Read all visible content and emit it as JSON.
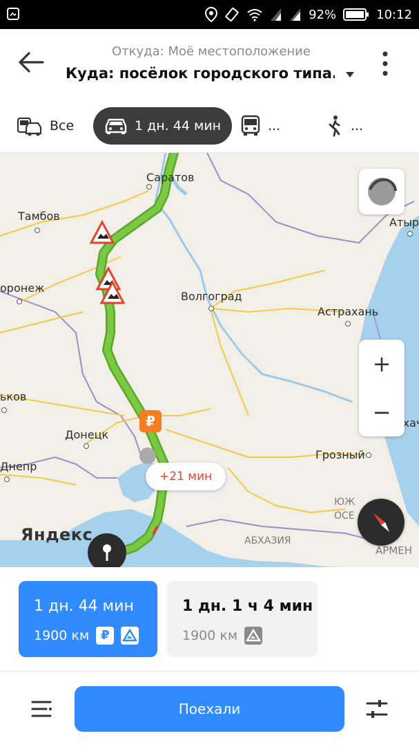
{
  "status_bar": {
    "battery": "92%",
    "time": "10:12",
    "icons": [
      "notification-icon",
      "location-icon",
      "vibrate-icon",
      "wifi-icon",
      "signal-icon",
      "signal-icon",
      "battery-icon"
    ]
  },
  "header": {
    "from": "Откуда: Моё местоположение",
    "to": "Куда: посёлок городского типа...",
    "icons": [
      "back-arrow-icon",
      "dropdown-triangle-icon",
      "more-vert-icon"
    ]
  },
  "modes": [
    {
      "label": "Все",
      "icon": "car-and-bus-icon"
    },
    {
      "label": "1 дн. 44 мин",
      "icon": "car-icon",
      "active": true
    },
    {
      "label": "...",
      "icon": "bus-icon"
    },
    {
      "label": "...",
      "icon": "walk-icon"
    }
  ],
  "map": {
    "cities": [
      "Саратов",
      "Тамбов",
      "Атыр",
      "оронеж",
      "Волгоград",
      "Астрахань",
      "ьков",
      "Донецк",
      "Махач",
      "Грозный",
      "Днепр",
      "ЮЖ",
      "ОСЕ",
      "АБХАЗИЯ",
      "АРМЕН"
    ],
    "logo": "Яндекс",
    "time_badge": "+21 мин",
    "toll_marker": "₽",
    "zoom_in": "+",
    "zoom_out": "−",
    "colors": {
      "route": "#7ac943",
      "land": "#f2efe9",
      "sea": "#a6d1ec",
      "roads": "#f5c842",
      "borders": "#9b8ec9"
    }
  },
  "routes": [
    {
      "time": "1 дн. 44 мин",
      "distance": "1900 км",
      "badges": [
        "₽",
        "road-warning-icon"
      ],
      "selected": true
    },
    {
      "time": "1 дн. 1 ч 4 мин",
      "distance": "1900 км",
      "badges": [
        "road-warning-icon"
      ],
      "selected": false
    }
  ],
  "actions": {
    "go": "Поехали",
    "icons": [
      "route-list-icon",
      "settings-sliders-icon"
    ]
  },
  "colors": {
    "accent": "#2f8bff",
    "dark_chip": "#3c3c3c",
    "alert": "#e0442d"
  }
}
